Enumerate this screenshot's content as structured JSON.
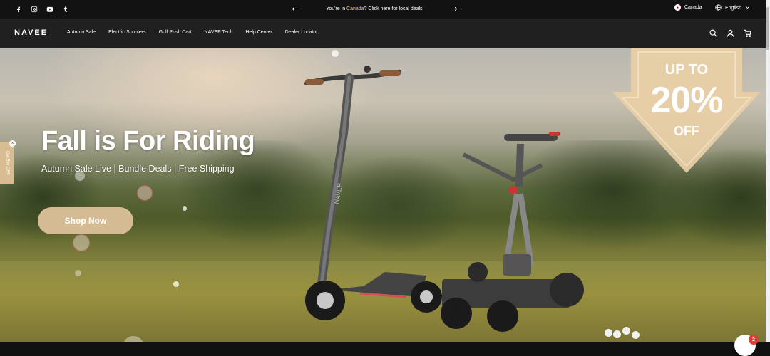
{
  "announcement": {
    "prefix": "You're in ",
    "country": "Canada",
    "suffix": "? Click here for local deals"
  },
  "region": {
    "label": "Canada"
  },
  "language": {
    "label": "English"
  },
  "logo": "NAVEE",
  "nav": [
    "Autumn Sale",
    "Electric Scooters",
    "Golf Push Cart",
    "NAVEE Tech",
    "Help Center",
    "Dealer Locator"
  ],
  "hero": {
    "headline": "Fall is For Riding",
    "subline": "Autumn Sale Live | Bundle Deals | Free Shipping",
    "cta": "Shop Now"
  },
  "promo": {
    "line1": "UP TO",
    "line2": "20%",
    "line3": "OFF"
  },
  "side_tab": "Get 5% OFF",
  "scooter_brand": "NAVEE",
  "chat": {
    "badge": "2"
  },
  "colors": {
    "accent": "#e8c07a",
    "cta": "#d4bb93",
    "badge": "#e53935"
  }
}
